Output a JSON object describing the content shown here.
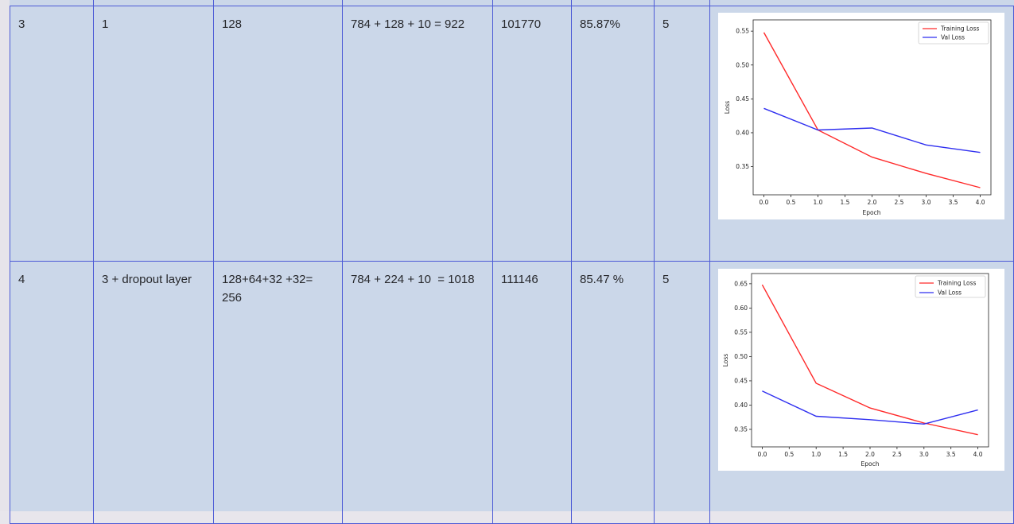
{
  "rows": [
    {
      "run": "3",
      "hidden_layers": "1",
      "neurons_line1": "128",
      "neurons_line2": "",
      "params_formula": "784 + 128 + 10 = 922",
      "params_total": "101770",
      "accuracy": "85.87%",
      "epochs": "5",
      "plot": {
        "legend": [
          "Training Loss",
          "Val Loss"
        ],
        "xlabel": "Epoch",
        "ylabel": "Loss",
        "x_ticks": [
          "0.0",
          "0.5",
          "1.0",
          "1.5",
          "2.0",
          "2.5",
          "3.0",
          "3.5",
          "4.0"
        ],
        "y_ticks": [
          "0.35",
          "0.40",
          "0.45",
          "0.50",
          "0.55"
        ]
      }
    },
    {
      "run": "4",
      "hidden_layers": "3 + dropout layer",
      "neurons_line1": "128+64+32 +32=",
      "neurons_line2": "256",
      "params_formula": "784 + 224 + 10  = 1018",
      "params_total": "111146",
      "accuracy": "85.47 %",
      "epochs": "5",
      "plot": {
        "legend": [
          "Training Loss",
          "Val Loss"
        ],
        "xlabel": "Epoch",
        "ylabel": "Loss",
        "x_ticks": [
          "0.0",
          "0.5",
          "1.0",
          "1.5",
          "2.0",
          "2.5",
          "3.0",
          "3.5",
          "4.0"
        ],
        "y_ticks": [
          "0.35",
          "0.40",
          "0.45",
          "0.50",
          "0.55",
          "0.60",
          "0.65"
        ]
      }
    }
  ],
  "chart_data": [
    {
      "type": "line",
      "xlabel": "Epoch",
      "ylabel": "Loss",
      "xlim": [
        0,
        4
      ],
      "ylim": [
        0.32,
        0.555
      ],
      "x": [
        0,
        1,
        2,
        3,
        4
      ],
      "series": [
        {
          "name": "Training Loss",
          "color": "#ff2a2a",
          "values": [
            0.548,
            0.404,
            0.364,
            0.34,
            0.319
          ]
        },
        {
          "name": "Val Loss",
          "color": "#2f2ff0",
          "values": [
            0.436,
            0.404,
            0.407,
            0.382,
            0.371
          ]
        }
      ],
      "legend": "top-right",
      "grid": false
    },
    {
      "type": "line",
      "xlabel": "Epoch",
      "ylabel": "Loss",
      "xlim": [
        0,
        4
      ],
      "ylim": [
        0.33,
        0.655
      ],
      "x": [
        0,
        1,
        2,
        3,
        4
      ],
      "series": [
        {
          "name": "Training Loss",
          "color": "#ff2a2a",
          "values": [
            0.648,
            0.445,
            0.394,
            0.363,
            0.339
          ]
        },
        {
          "name": "Val Loss",
          "color": "#2f2ff0",
          "values": [
            0.429,
            0.377,
            0.37,
            0.361,
            0.39
          ]
        }
      ],
      "legend": "top-right",
      "grid": false
    }
  ]
}
